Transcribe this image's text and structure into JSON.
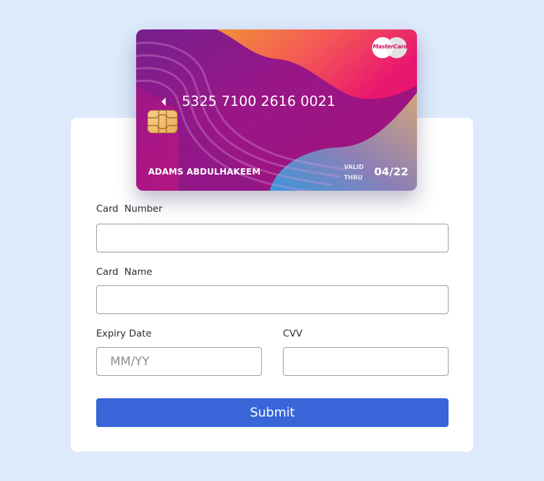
{
  "card": {
    "number": "5325 7100 2616 0021",
    "holder_name": "ADAMS ABDULHAKEEM",
    "valid_label_line1": "VALID",
    "valid_label_line2": "THRU",
    "expiry": "04/22",
    "brand": "MasterCard",
    "colors": {
      "purple": "#7a1f8c",
      "magenta": "#b8127e",
      "orange": "#f0883a",
      "pink": "#ee2d6e",
      "blue": "#3b93dc",
      "tan": "#c8a17c"
    }
  },
  "form": {
    "card_number": {
      "label": "Card  Number",
      "value": "",
      "placeholder": ""
    },
    "card_name": {
      "label": "Card  Name",
      "value": "",
      "placeholder": ""
    },
    "expiry_date": {
      "label": "Expiry Date",
      "value": "",
      "placeholder": "MM/YY"
    },
    "cvv": {
      "label": "CVV",
      "value": "",
      "placeholder": ""
    },
    "submit_label": "Submit"
  },
  "theme": {
    "page_background": "#ddeafc",
    "panel_background": "#ffffff",
    "primary_button": "#3866d9"
  }
}
